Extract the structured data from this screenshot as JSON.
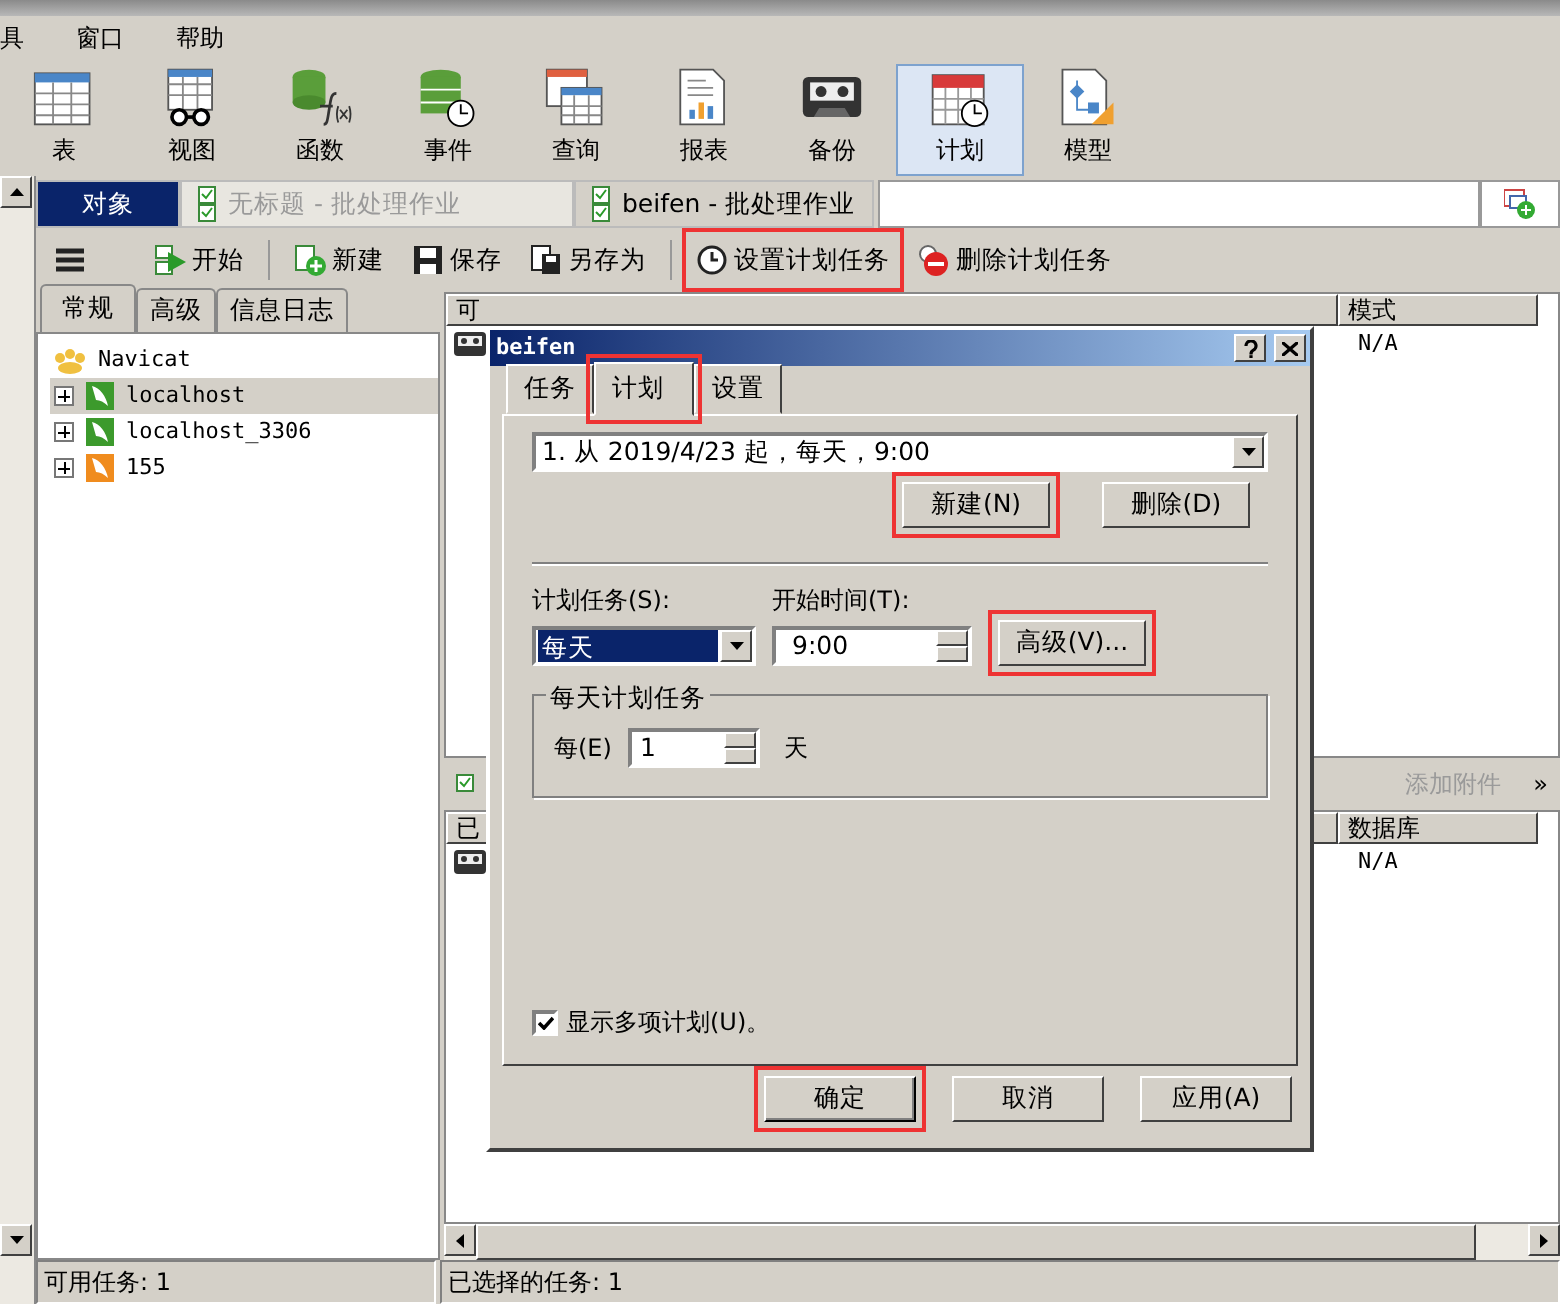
{
  "menu_bar": [
    "具",
    "窗口",
    "帮助"
  ],
  "ribbon": [
    {
      "label": "表",
      "selected": false
    },
    {
      "label": "视图",
      "selected": false
    },
    {
      "label": "函数",
      "selected": false
    },
    {
      "label": "事件",
      "selected": false
    },
    {
      "label": "查询",
      "selected": false
    },
    {
      "label": "报表",
      "selected": false
    },
    {
      "label": "备份",
      "selected": false
    },
    {
      "label": "计划",
      "selected": true
    },
    {
      "label": "模型",
      "selected": false
    }
  ],
  "doc_tabs": [
    {
      "label": "对象",
      "selected": true,
      "disabled": false
    },
    {
      "label": "无标题 - 批处理作业",
      "selected": false,
      "disabled": true
    },
    {
      "label": "beifen - 批处理作业",
      "selected": false,
      "disabled": false
    }
  ],
  "toolbar": [
    {
      "label": "开始",
      "highlighted": false
    },
    {
      "label": "新建",
      "highlighted": false
    },
    {
      "label": "保存",
      "highlighted": false
    },
    {
      "label": "另存为",
      "highlighted": false
    },
    {
      "label": "设置计划任务",
      "highlighted": true
    },
    {
      "label": "删除计划任务",
      "highlighted": false
    }
  ],
  "left_panel": {
    "tabs": [
      {
        "label": "常规",
        "selected": true
      },
      {
        "label": "高级",
        "selected": false
      },
      {
        "label": "信息日志",
        "selected": false
      }
    ],
    "tree": [
      {
        "label": "Navicat",
        "kind": "group",
        "selected": false,
        "children": [
          {
            "label": "localhost",
            "kind": "connection",
            "color": "#3c9a2c",
            "selected": true,
            "expanded": false
          },
          {
            "label": "localhost_3306",
            "kind": "connection",
            "color": "#3c9a2c",
            "selected": false,
            "expanded": false
          },
          {
            "label": "155",
            "kind": "connection",
            "color": "#f08c1e",
            "selected": false,
            "expanded": false
          }
        ]
      }
    ]
  },
  "available_list": {
    "columns": [
      "可",
      "模式"
    ],
    "rows": [
      {
        "mode": "N/A"
      }
    ]
  },
  "mid_toolbar": {
    "attach": "添加附件",
    "attach_disabled": true,
    "more": "»"
  },
  "selected_list": {
    "columns": [
      "已",
      "数据库"
    ],
    "rows": [
      {
        "database": "N/A"
      }
    ]
  },
  "status_bar": [
    "可用任务: 1",
    "已选择的任务: 1"
  ],
  "dialog": {
    "title": "beifen",
    "tabs": [
      {
        "label": "任务",
        "selected": false,
        "highlighted": false
      },
      {
        "label": "计划",
        "selected": true,
        "highlighted": true
      },
      {
        "label": "设置",
        "selected": false,
        "highlighted": false
      }
    ],
    "schedule_list": "1. 从 2019/4/23 起，每天，9:00",
    "list_buttons": [
      {
        "label": "新建(N)",
        "highlighted": true
      },
      {
        "label": "删除(D)",
        "highlighted": false
      }
    ],
    "schedule_label": "计划任务(S):",
    "schedule_value": "每天",
    "start_label": "开始时间(T):",
    "start_value": "9:00",
    "advanced": {
      "label": "高级(V)...",
      "highlighted": true
    },
    "group": {
      "title": "每天计划任务",
      "every_label": "每(E)",
      "every_value": "1",
      "unit": "天"
    },
    "show_multiple": {
      "label": "显示多项计划(U)。",
      "checked": true
    },
    "footer_buttons": [
      {
        "label": "确定",
        "highlighted": true
      },
      {
        "label": "取消",
        "highlighted": false
      },
      {
        "label": "应用(A)",
        "highlighted": false
      }
    ]
  }
}
